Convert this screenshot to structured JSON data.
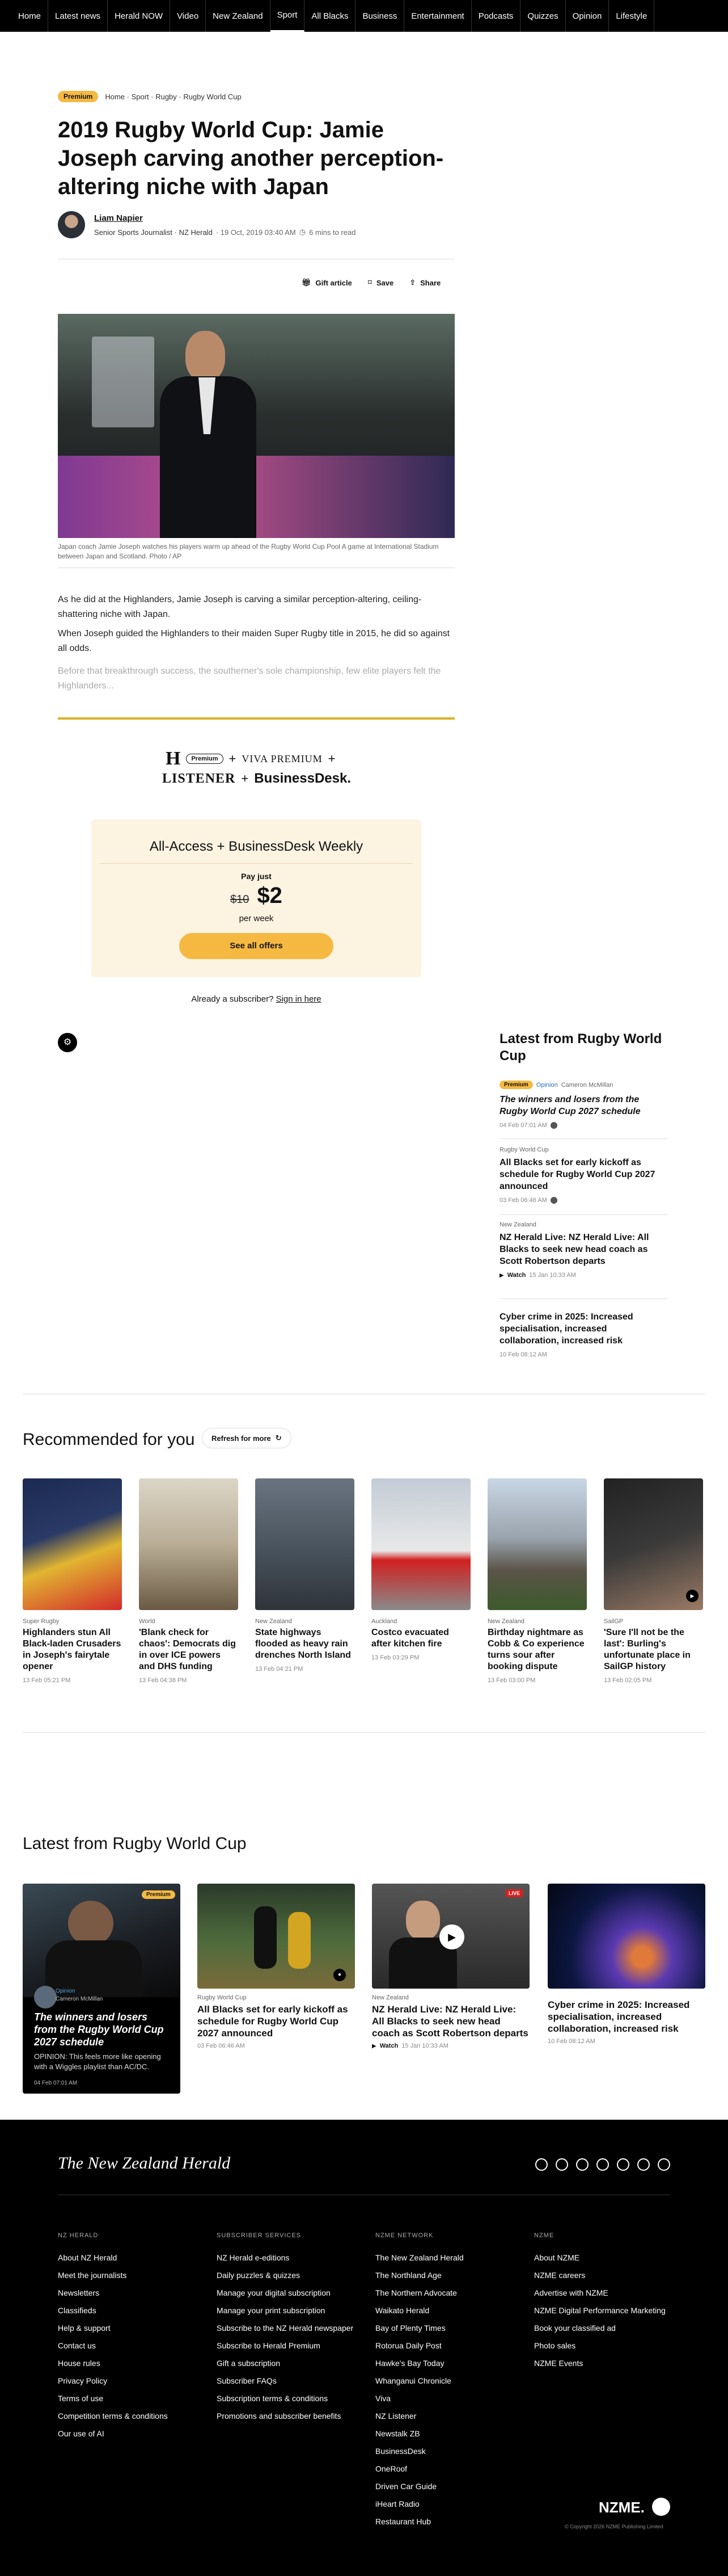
{
  "nav": {
    "items": [
      "Home",
      "Latest news",
      "Herald NOW",
      "Video",
      "New Zealand",
      "Sport",
      "All Blacks",
      "Business",
      "Entertainment",
      "Podcasts",
      "Quizzes",
      "Opinion",
      "Lifestyle"
    ],
    "active": "Sport"
  },
  "article": {
    "badge": "Premium",
    "breadcrumb": "Home · Sport · Rugby · Rugby World Cup",
    "title": "2019 Rugby World Cup: Jamie Joseph carving another perception-altering niche with Japan",
    "author": "Liam Napier",
    "author_role": "Senior Sports Journalist · NZ Herald",
    "date": "· 19 Oct, 2019 03:40 AM",
    "read_time": "6 mins to read",
    "tools": {
      "gift": "Gift article",
      "save": "Save",
      "share": "Share"
    },
    "caption": "Japan coach Jamie Joseph watches his players warm up ahead of the Rugby World Cup Pool A game at International Stadium between Japan and Scotland. Photo / AP",
    "p1": "As he did at the Highlanders, Jamie Joseph is carving a similar perception-altering, ceiling-shattering niche with Japan.",
    "p2": "When Joseph guided the Highlanders to their maiden Super Rugby title in 2015, he did so against all odds.",
    "p3": "Before that breakthrough success, the southerner's sole championship, few elite players felt the Highlanders..."
  },
  "paywall": {
    "logo_h": "H",
    "logo_premium": "Premium",
    "logo_viva": "VIVA PREMIUM",
    "plus": "+",
    "logo_listener": "LISTENER",
    "logo_bd": "BusinessDesk.",
    "offer_title": "All-Access + BusinessDesk Weekly",
    "pay_just": "Pay just",
    "old_price": "$10",
    "price": "$2",
    "per": "per week",
    "cta": "See all offers",
    "subscriber_text": "Already a subscriber?",
    "sign_in": "Sign in here"
  },
  "sidebar": {
    "title": "Latest from Rugby World Cup",
    "items": [
      {
        "badge": "Premium",
        "tag": "Opinion",
        "author": "Cameron McMillan",
        "title": "The winners and losers from the Rugby World Cup 2027 schedule",
        "date": "04 Feb 07:01 AM"
      },
      {
        "tag": "Rugby World Cup",
        "title": "All Blacks set for early kickoff as schedule for Rugby World Cup 2027 announced",
        "date": "03 Feb 06:46 AM"
      },
      {
        "tag": "New Zealand",
        "title": "NZ Herald Live: NZ Herald Live: All Blacks to seek new head coach as Scott Robertson departs",
        "watch": "Watch",
        "date": "15 Jan 10:33 AM"
      },
      {
        "title": "Cyber crime in 2025: Increased specialisation, increased collaboration, increased risk",
        "date": "10 Feb 08:12 AM"
      }
    ]
  },
  "recommended": {
    "title": "Recommended for you",
    "refresh": "Refresh for more",
    "items": [
      {
        "tag": "Super Rugby",
        "title": "Highlanders stun All Black-laden Crusaders in Joseph's fairytale opener",
        "date": "13 Feb 05:21 PM"
      },
      {
        "tag": "World",
        "title": "'Blank check for chaos': Democrats dig in over ICE powers and DHS funding",
        "date": "13 Feb 04:38 PM"
      },
      {
        "tag": "New Zealand",
        "title": "State highways flooded as heavy rain drenches North Island",
        "date": "13 Feb 04:21 PM"
      },
      {
        "tag": "Auckland",
        "title": "Costco evacuated after kitchen fire",
        "date": "13 Feb 03:29 PM"
      },
      {
        "tag": "New Zealand",
        "title": "Birthday nightmare as Cobb & Co experience turns sour after booking dispute",
        "date": "13 Feb 03:00 PM"
      },
      {
        "tag": "SailGP",
        "title": "'Sure I'll not be the last': Burling's unfortunate place in SailGP history",
        "date": "13 Feb 02:05 PM"
      }
    ]
  },
  "latest": {
    "title": "Latest from Rugby World Cup",
    "items": [
      {
        "badge": "Premium",
        "tag": "Opinion",
        "author": "Cameron McMillan",
        "title": "The winners and losers from the Rugby World Cup 2027 schedule",
        "summary": "OPINION: This feels more like opening with a Wiggles playlist than AC/DC.",
        "date": "04 Feb 07:01 AM"
      },
      {
        "tag": "Rugby World Cup",
        "title": "All Blacks set for early kickoff as schedule for Rugby World Cup 2027 announced",
        "date": "03 Feb 06:46 AM"
      },
      {
        "tag": "New Zealand",
        "title": "NZ Herald Live: NZ Herald Live: All Blacks to seek new head coach as Scott Robertson departs",
        "watch": "Watch",
        "date": "15 Jan 10:33 AM",
        "live": "LIVE"
      },
      {
        "title": "Cyber crime in 2025: Increased specialisation, increased collaboration, increased risk",
        "date": "10 Feb 08:12 AM"
      }
    ]
  },
  "footer": {
    "logo": "The New Zealand Herald",
    "cols": [
      {
        "h": "NZ HERALD",
        "links": [
          "About NZ Herald",
          "Meet the journalists",
          "Newsletters",
          "Classifieds",
          "Help & support",
          "Contact us",
          "House rules",
          "Privacy Policy",
          "Terms of use",
          "Competition terms & conditions",
          "Our use of AI"
        ]
      },
      {
        "h": "SUBSCRIBER SERVICES",
        "links": [
          "NZ Herald e-editions",
          "Daily puzzles & quizzes",
          "Manage your digital subscription",
          "Manage your print subscription",
          "Subscribe to the NZ Herald newspaper",
          "Subscribe to Herald Premium",
          "Gift a subscription",
          "Subscriber FAQs",
          "Subscription terms & conditions",
          "Promotions and subscriber benefits"
        ]
      },
      {
        "h": "NZME NETWORK",
        "links": [
          "The New Zealand Herald",
          "The Northland Age",
          "The Northern Advocate",
          "Waikato Herald",
          "Bay of Plenty Times",
          "Rotorua Daily Post",
          "Hawke's Bay Today",
          "Whanganui Chronicle",
          "Viva",
          "NZ Listener",
          "Newstalk ZB",
          "BusinessDesk",
          "OneRoof",
          "Driven Car Guide",
          "iHeart Radio",
          "Restaurant Hub"
        ]
      },
      {
        "h": "NZME",
        "links": [
          "About NZME",
          "NZME careers",
          "Advertise with NZME",
          "NZME Digital Performance Marketing",
          "Book your classified ad",
          "Photo sales",
          "NZME Events"
        ]
      }
    ],
    "brand": "NZME.",
    "copyright": "© Copyright 2026 NZME Publishing Limited"
  },
  "colors": {
    "accent": "#f5b942",
    "offer_bg": "#fdf3e1",
    "footer_bg": "#000000"
  }
}
